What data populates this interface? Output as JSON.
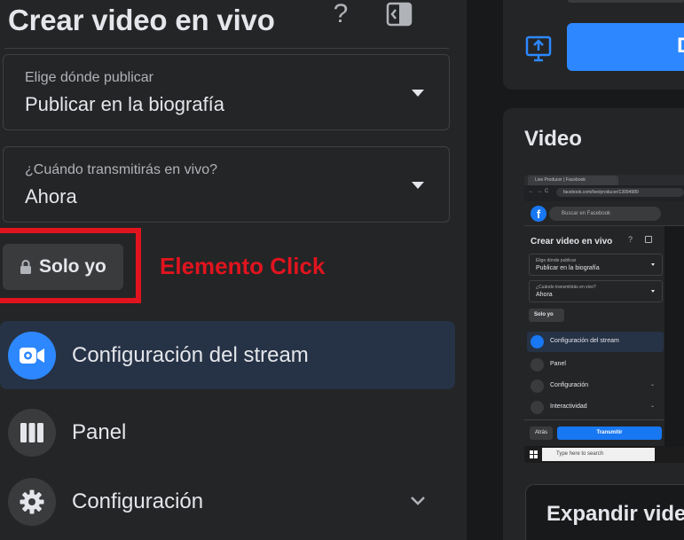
{
  "panel": {
    "title": "Crear video en vivo",
    "help_icon_glyph": "?",
    "post_to": {
      "label": "Elige dónde publicar",
      "value": "Publicar en la biografía"
    },
    "when": {
      "label": "¿Cuándo transmitirás en vivo?",
      "value": "Ahora"
    },
    "privacy": {
      "label": "Solo yo"
    },
    "annotation": "Elemento Click",
    "menu": [
      {
        "label": "Configuración del stream",
        "icon": "camera-icon",
        "active": true
      },
      {
        "label": "Panel",
        "icon": "panel-icon",
        "active": false
      },
      {
        "label": "Configuración",
        "icon": "gear-icon",
        "active": false
      }
    ]
  },
  "right": {
    "primary_button_label": "D",
    "video_title": "Video",
    "expand_title": "Expandir vide",
    "thumbnail": {
      "tab_title": "Live Producer | Facebook",
      "url": "facebook.com/live/producer/13994989",
      "search_placeholder": "Buscar en Facebook",
      "title": "Crear video en vivo",
      "post_label": "Elige dónde publicar",
      "post_value": "Publicar en la biografía",
      "when_label": "¿Cuándo transmitirás en vivo?",
      "when_value": "Ahora",
      "privacy": "Solo yo",
      "items": [
        "Configuración del stream",
        "Panel",
        "Configuración",
        "Interactividad"
      ],
      "back": "Atrás",
      "go_live": "Transmitir",
      "taskbar_search": "Type here to search"
    }
  },
  "colors": {
    "accent": "#2d88ff",
    "annotation": "#e0141e",
    "panel_bg": "#242526",
    "page_bg": "#18191a"
  }
}
